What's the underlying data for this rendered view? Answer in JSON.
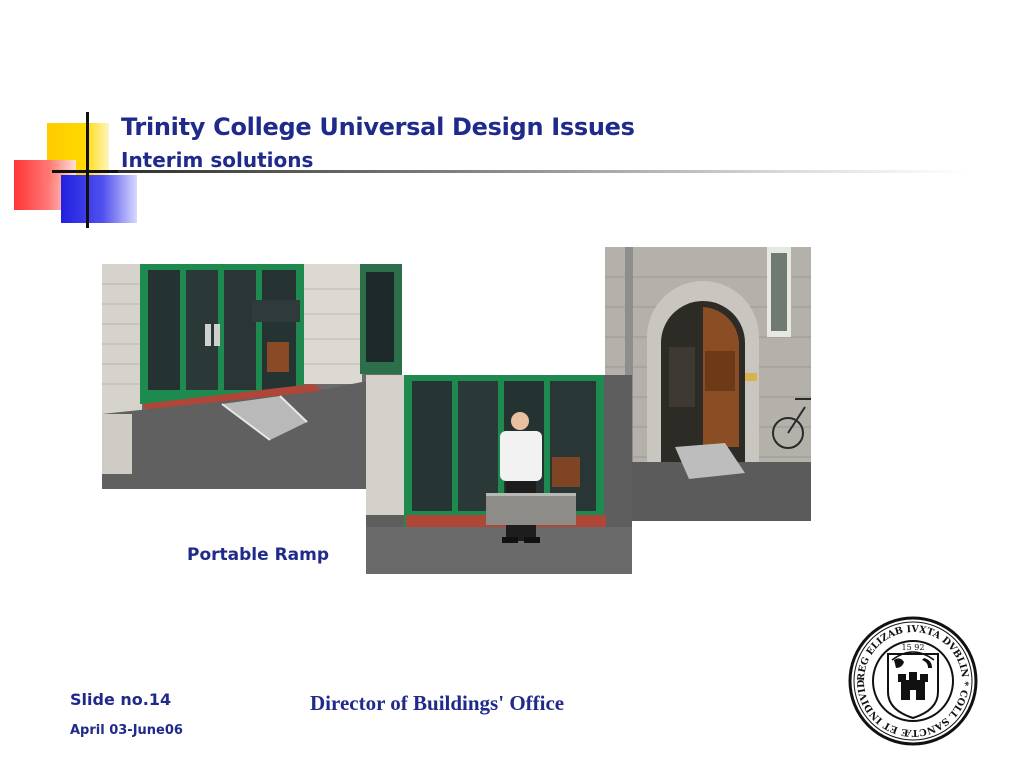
{
  "slide": {
    "title": "Trinity College Universal Design Issues",
    "subtitle": "Interim solutions",
    "caption": "Portable Ramp",
    "slide_number": "Slide no.14",
    "date_range": "April 03-June06",
    "footer": "Director of Buildings' Office"
  },
  "seal": {
    "ring_text": "REG ELIZAB IVXTA DVBLIN * COLL SANCTÆ ET INDIVIDUÆ TRINITATIS",
    "year": "15 92"
  },
  "colors": {
    "title": "#1f2a8a",
    "accent_yellow": "#ffcc00",
    "accent_red": "#ff2a2a",
    "accent_blue": "#2020e0"
  },
  "photos": [
    {
      "name": "ramp-at-glass-doors"
    },
    {
      "name": "man-holding-portable-ramp"
    },
    {
      "name": "arched-stone-doorway-with-ramp"
    }
  ]
}
